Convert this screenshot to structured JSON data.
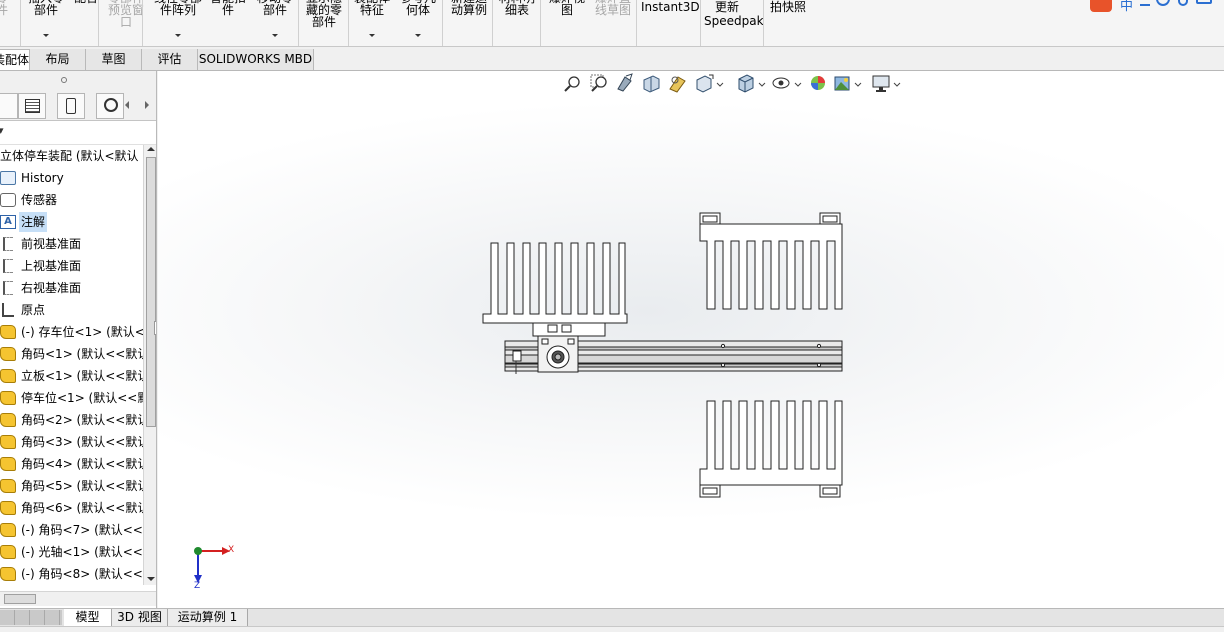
{
  "ribbon": {
    "items": [
      {
        "label": "零\n件",
        "disabled": true,
        "arrow": false
      },
      {
        "label": "插入零\n部件",
        "disabled": false,
        "arrow": true
      },
      {
        "label": "配合",
        "disabled": false,
        "arrow": false
      },
      {
        "label": "零部件\n预览窗\n口",
        "disabled": true,
        "arrow": false
      },
      {
        "label": "线性零部\n件阵列",
        "disabled": false,
        "arrow": true
      },
      {
        "label": "智能扣\n件",
        "disabled": false,
        "arrow": false
      },
      {
        "label": "移动零\n部件",
        "disabled": false,
        "arrow": true
      },
      {
        "label": "显示隐\n藏的零\n部件",
        "disabled": false,
        "arrow": false
      },
      {
        "label": "装配体\n特征",
        "disabled": false,
        "arrow": true
      },
      {
        "label": "参考几\n何体",
        "disabled": false,
        "arrow": true
      },
      {
        "label": "新建运\n动算例",
        "disabled": false,
        "arrow": false
      },
      {
        "label": "材料明\n细表",
        "disabled": false,
        "arrow": false
      },
      {
        "label": "爆炸视\n图",
        "disabled": false,
        "arrow": false
      },
      {
        "label": "爆炸直\n线草图",
        "disabled": true,
        "arrow": false
      },
      {
        "label": "Instant3D",
        "disabled": false,
        "arrow": false
      },
      {
        "label": "更新\nSpeedpak",
        "disabled": false,
        "arrow": false
      },
      {
        "label": "拍快照",
        "disabled": false,
        "arrow": false
      }
    ],
    "ime_label": "中"
  },
  "tabs": [
    "装配体",
    "布局",
    "草图",
    "评估",
    "SOLIDWORKS MBD"
  ],
  "tree": {
    "filter_label": "▾",
    "items": [
      {
        "label": "立体停车装配  (默认<默认",
        "icon": "assembly-icon",
        "type": "root"
      },
      {
        "label": "History",
        "icon": "history-icon",
        "type": "hist"
      },
      {
        "label": "传感器",
        "icon": "sensor-icon",
        "type": "sens"
      },
      {
        "label": "注解",
        "icon": "annotation-icon",
        "type": "anno",
        "selected": true
      },
      {
        "label": "前视基准面",
        "icon": "plane-icon",
        "type": "plane"
      },
      {
        "label": "上视基准面",
        "icon": "plane-icon",
        "type": "plane"
      },
      {
        "label": "右视基准面",
        "icon": "plane-icon",
        "type": "plane"
      },
      {
        "label": "原点",
        "icon": "origin-icon",
        "type": "origin"
      },
      {
        "label": "(-) 存车位<1> (默认<",
        "icon": "part-icon",
        "type": "part"
      },
      {
        "label": "角码<1> (默认<<默认",
        "icon": "part-icon",
        "type": "part"
      },
      {
        "label": "立板<1> (默认<<默认",
        "icon": "part-icon",
        "type": "part"
      },
      {
        "label": "停车位<1> (默认<<默",
        "icon": "part-icon",
        "type": "part"
      },
      {
        "label": "角码<2> (默认<<默认",
        "icon": "part-icon",
        "type": "part"
      },
      {
        "label": "角码<3> (默认<<默认",
        "icon": "part-icon",
        "type": "part"
      },
      {
        "label": "角码<4> (默认<<默认",
        "icon": "part-icon",
        "type": "part"
      },
      {
        "label": "角码<5> (默认<<默认",
        "icon": "part-icon",
        "type": "part"
      },
      {
        "label": "角码<6> (默认<<默认",
        "icon": "part-icon",
        "type": "part"
      },
      {
        "label": "(-) 角码<7> (默认<<默",
        "icon": "part-icon",
        "type": "part"
      },
      {
        "label": "(-) 光轴<1> (默认<<默",
        "icon": "part-icon",
        "type": "part"
      },
      {
        "label": "(-) 角码<8> (默认<<默",
        "icon": "part-icon",
        "type": "part"
      }
    ]
  },
  "bottom_tabs": [
    "模型",
    "3D 视图",
    "运动算例 1"
  ],
  "triad": {
    "x_label": "X",
    "z_label": "Z"
  },
  "colors": {
    "selected": "#c6dff7",
    "part_icon": "#f5c430",
    "triad_x": "#d42020",
    "triad_z": "#2030c8"
  }
}
